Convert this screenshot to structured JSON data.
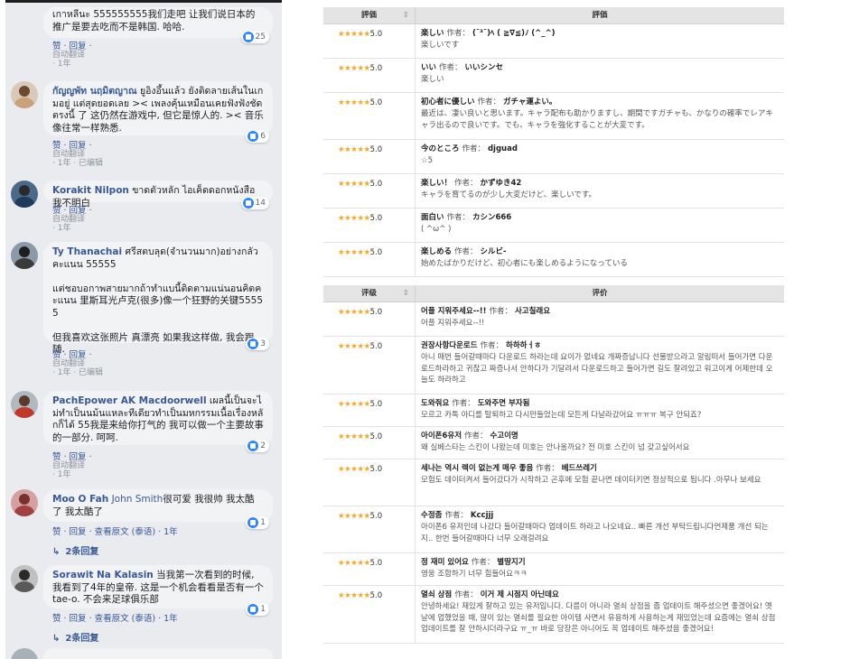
{
  "facebook": {
    "comments": [
      {
        "name": "",
        "text": "เกาหลีนะ 555555555我们走吧 让我们说日本的推广是要去吃而不是韩国. 哈哈.",
        "reactions": "25",
        "actions": "赞 · 回复 ·",
        "meta1": "自动翻译",
        "meta2": "· 1年"
      },
      {
        "name": "กัญญพัท นฤมิตญาณ",
        "text": " ยูอิงอึ้นแล้ว ยังติดลายเส้นในเกมอยู่ แต่สุดยอดเลย >< เพลงคุ้นเหมือนเคยฟังฟังชัดตรงนี้ 了 这仍然在游戏中, 但它是惊人的. >< 音乐像往常一样熟悉.",
        "reactions": "6",
        "actions": "赞 · 回复 ·",
        "meta1": "自动翻译",
        "meta2": "· 1年 · 已编辑"
      },
      {
        "name": "Korakit Nilpon",
        "text": " ขาดตัวหลัก ไอเค็ดดอกหนังสือ 我不明白",
        "reactions": "14",
        "actions": "赞 · 回复 ·",
        "meta1": "自动翻译",
        "meta2": "· 1年"
      },
      {
        "name": "Ty Thanachai",
        "text": " ศรีสตบลุด(จำนวนมาก)อย่างกลัว คะแนน 55555\n\nแต่ชอบอกาพสายมากถ้าทำแบนี้ติดตามแน่นอนคิดคะแนน 里斯耳光卢克(很多)像一个狂野的关键55555\n\n但我喜欢这张照片 真漂亮 如果我这样做, 我会跟随.",
        "reactions": "3",
        "actions": "赞 · 回复 ·",
        "meta1": "自动翻译",
        "meta2": "· 1年 · 已编辑"
      },
      {
        "name": "PachEpower AK Macdoorwell",
        "text": " เผลนี้เป็นจะไม่ทำเป็นนม้นแหละทีเดียวทำเป็นมหกรรมเนื้อเรื่องหลักก็ได้ 55我是来给你打气的 我可以做一个主要故事的一部分. 呵呵.",
        "reactions": "2",
        "actions": "赞 · 回复 ·",
        "meta1": "自动翻译",
        "meta2": "· 1年"
      },
      {
        "name": "Moo O Fah",
        "mention": "John Smith",
        "text": "很可爱 我很帅 我太酷了 我太酷了",
        "reactions": "1",
        "actions": "赞 · 回复 · 查看原文 (泰语) · 1年",
        "replies": "2条回复"
      },
      {
        "name": "Sorawit Na Kalasin",
        "text": " 当我第一次看到的时候, 我看到了4年的皇帝. 这是一个机会看看是否有一个tae-o. 不会来足球俱乐部",
        "reactions": "1",
        "actions": "赞 · 回复 · 查看原文 (泰语) · 1年",
        "replies": "2条回复"
      }
    ]
  },
  "table1": {
    "header_rating": "評価",
    "header_review": "評価",
    "rows": [
      {
        "stars": "★★★★★",
        "score": "5.0",
        "title": "楽しい",
        "author_label": "作者：",
        "author": "(¯³¯)ﾍ ( ≧∇≦)ﾉ (^_^)",
        "body": "楽しいです"
      },
      {
        "stars": "★★★★★",
        "score": "5.0",
        "title": "いい",
        "author_label": "作者：",
        "author": "いいシンセ",
        "body": "楽しい"
      },
      {
        "stars": "★★★★★",
        "score": "5.0",
        "title": "初心者に優しい",
        "author_label": "作者：",
        "author": "ガチャ運よい。",
        "body": "最近は、凄い良いと思います。キャラ配布も助かりますし、期間ですガチャも、かなりの確率でレアキャラ出るので良いです。でも、キャラを強化することが大変です。"
      },
      {
        "stars": "★★★★★",
        "score": "5.0",
        "title": "今のところ",
        "author_label": "作者：",
        "author": "djguad",
        "body": "☆5"
      },
      {
        "stars": "★★★★★",
        "score": "5.0",
        "title": "楽しい！",
        "author_label": "作者：",
        "author": "かずゆき42",
        "body": "キャラを育てるのが少し大変だけど、楽しいです。"
      },
      {
        "stars": "★★★★★",
        "score": "5.0",
        "title": "面白い",
        "author_label": "作者：",
        "author": "カシン666",
        "body": "( ^ω^ )"
      },
      {
        "stars": "★★★★★",
        "score": "5.0",
        "title": "楽しめる",
        "author_label": "作者：",
        "author": "シルビ-",
        "body": "始めたばかりだけど、初心者にも楽しめるようになっている"
      }
    ]
  },
  "table2": {
    "header_rating": "评级",
    "header_review": "评价",
    "rows": [
      {
        "stars": "★★★★★",
        "score": "5.0",
        "title": "어플 지워주세요--!!",
        "author_label": "作者：",
        "author": "사고칠래요",
        "body": "어플 지워주세요--!!"
      },
      {
        "stars": "★★★★★",
        "score": "5.0",
        "title": "권장사항다운로드",
        "author_label": "作者：",
        "author": "하하하ㅓㅎ",
        "body": "아니 매번 들어갈때마다 다운로드 하라는데 요이가 없네요 개짜증납니다 선물받으라고 알림떠서 들어가면 다운로드하라하고 귀찮고 짜증나서 안하다가 기달려서 다운로드하고 들어가면 길도 잘려있고 워고이게 어제한데 오늘도 하라하고"
      },
      {
        "stars": "★★★★★",
        "score": "5.0",
        "title": "도와줘요",
        "author_label": "作者：",
        "author": "도와주면 부자됨",
        "body": "모르고 카톡 아디를 탈퇴하고 다시만들었는데 모든게 다날라갔어요 ㅠㅠㅠ 복구 안되죠?"
      },
      {
        "stars": "★★★★★",
        "score": "5.0",
        "title": "아이폰6유저",
        "author_label": "作者：",
        "author": "수고이명",
        "body": "왜 실베스타는 스킨이 나왔는데 미호는 안나올까요? 전 미호 스킨이 넘 갖고싶어서요"
      },
      {
        "stars": "★★★★★",
        "score": "5.0",
        "title": "세나는 역시 렉이 없는게 매우 좋음",
        "author_label": "作者：",
        "author": "베드쓰레기",
        "body": "모험도 데이터켜서 들어갔다가 시작하고 곤후에 모험 끝나면 데이터키면 정상적으로 됩니다 .아무나 보세요"
      },
      {
        "stars": "★★★★★",
        "score": "5.0",
        "title": "수정좀",
        "author_label": "作者：",
        "author": "Kccjjj",
        "body": "아이폰6 유저인데 나갔다 들어갈때마다 업데이트 하라고 나오네요.. 빠른 개선 부탁드립니다언제품 개선 되는지.. 한번 들어갈때마다 너무 오래걸려요"
      },
      {
        "stars": "★★★★★",
        "score": "5.0",
        "title": "정 재미 있어요",
        "author_label": "作者：",
        "author": "별땅지기",
        "body": "영웅 조합하기 너무 힘들어요ㅋㅋ"
      },
      {
        "stars": "★★★★★",
        "score": "5.0",
        "title": "열쇠 상점",
        "author_label": "作者：",
        "author": "이거 제 시점지 아닌데요",
        "body": "안녕하세요! 재있게 잘하고 있는 유저입니다. 다름이 아니라 열쇠 상점을 좀 업데이트 해주셨으면 좋겠어요! 옛날에 업했었을 때, 많이 있는 열쇠를 필요한 아이템 사면서 유용하게 사용하는게 재밌었는데 요즘에는 열쇠 상점 업데이트를 잘 안하시더라구요 ㅠ_ㅠ 바로 당장은 아니어도 꼭 업데이트 해주셨음 좋겠어요!"
      }
    ]
  }
}
